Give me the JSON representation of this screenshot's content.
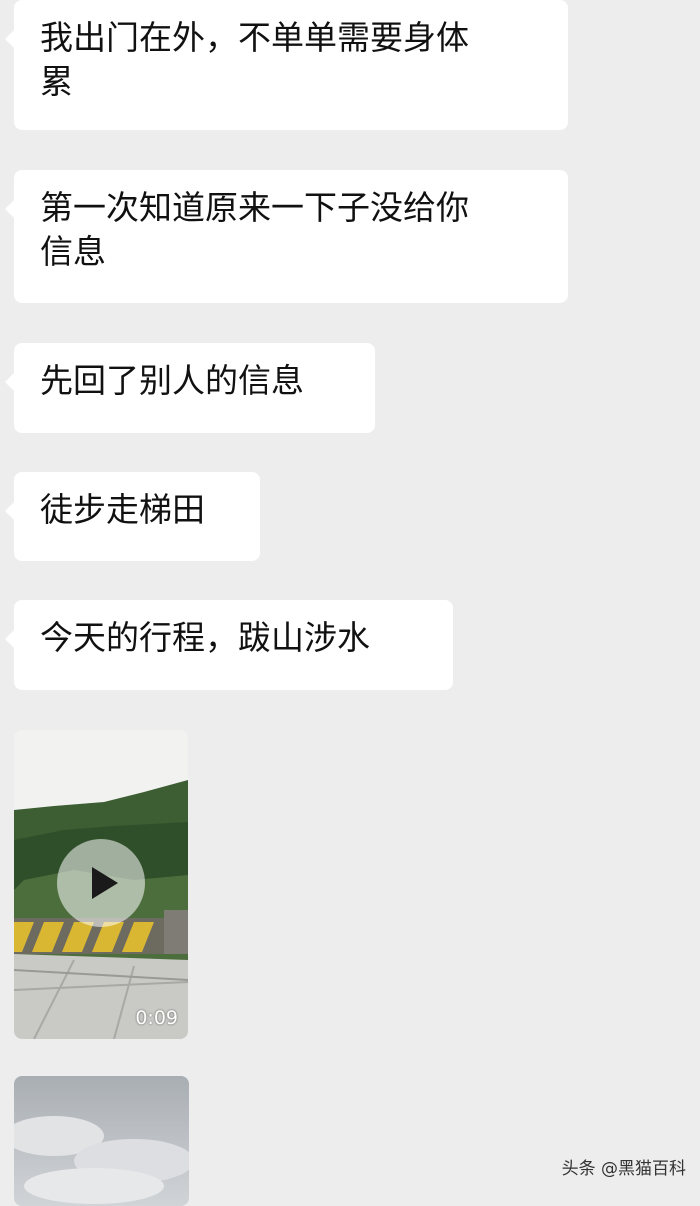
{
  "messages": [
    {
      "text": "我出门在外，不单单需要身体\n累"
    },
    {
      "text": "第一次知道原来一下子没给你\n信息"
    },
    {
      "text": "先回了别人的信息"
    },
    {
      "text": "徒步走梯田"
    },
    {
      "text": "今天的行程，跋山涉水"
    }
  ],
  "video": {
    "duration": "0:09",
    "icon": "play-icon"
  },
  "watermark": "头条 @黑猫百科",
  "colors": {
    "background": "#ededed",
    "bubble": "#ffffff",
    "text": "#111111"
  }
}
